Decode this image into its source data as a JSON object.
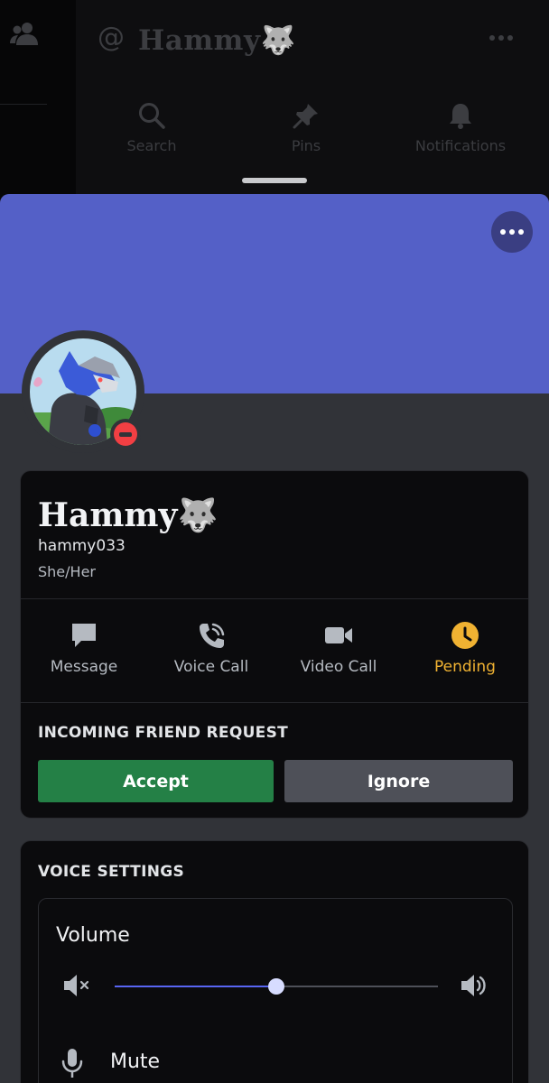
{
  "background": {
    "channel_title": "Hammy🐺",
    "at_symbol": "@",
    "tools": [
      {
        "label": "Search",
        "icon": "search-icon"
      },
      {
        "label": "Pins",
        "icon": "pin-icon"
      },
      {
        "label": "Notifications",
        "icon": "bell-icon"
      }
    ]
  },
  "profile": {
    "display_name": "Hammy🐺",
    "username": "hammy033",
    "pronouns": "She/Her",
    "status": "do-not-disturb",
    "banner_color": "#5460c7"
  },
  "actions": [
    {
      "label": "Message",
      "icon": "message-icon"
    },
    {
      "label": "Voice Call",
      "icon": "phone-icon"
    },
    {
      "label": "Video Call",
      "icon": "video-icon"
    },
    {
      "label": "Pending",
      "icon": "clock-icon"
    }
  ],
  "friend_request": {
    "title": "INCOMING FRIEND REQUEST",
    "accept_label": "Accept",
    "ignore_label": "Ignore",
    "accept_color": "#248046",
    "ignore_color": "#4e5058"
  },
  "voice_settings": {
    "title": "VOICE SETTINGS",
    "volume_label": "Volume",
    "volume_fraction": 0.5,
    "mute_label": "Mute"
  },
  "colors": {
    "pending": "#f0b232",
    "dnd": "#f23f43",
    "accent": "#5865f2"
  }
}
